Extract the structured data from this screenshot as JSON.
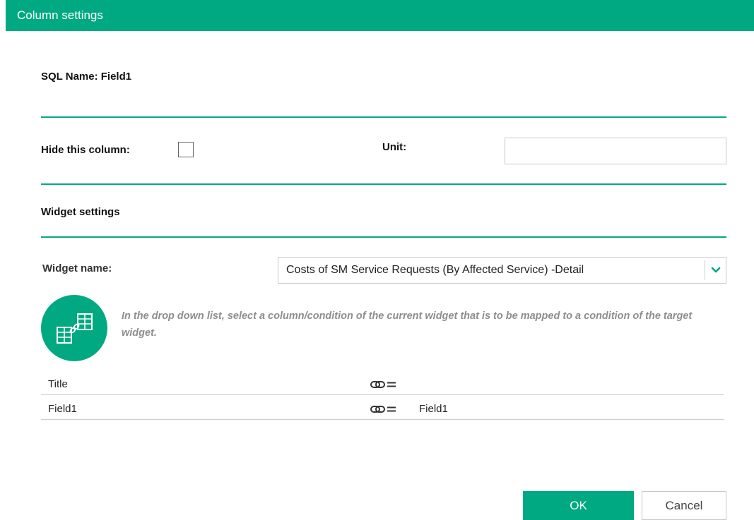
{
  "dialog": {
    "title": "Column settings",
    "sql_name": "SQL Name: Field1",
    "hide_column_label": "Hide this column:",
    "hide_column_checked": false,
    "unit_label": "Unit:",
    "unit_value": "",
    "widget_settings_heading": "Widget settings",
    "widget_name_label": "Widget name:",
    "widget_name_value": "Costs of SM Service Requests (By Affected Service) -Detail",
    "hint": "In the drop down list, select a column/condition of the current widget that is to be mapped to a condition of the target widget.",
    "mapping_rows": [
      {
        "column": "Title",
        "target": ""
      },
      {
        "column": "Field1",
        "target": "Field1"
      }
    ],
    "ok_label": "OK",
    "cancel_label": "Cancel"
  },
  "colors": {
    "accent": "#01a982",
    "hint_text": "#8e8e8e",
    "divider": "#01a982"
  },
  "icons": {
    "dropdown": "chevron-down-icon",
    "mapping": "table-link-icon",
    "link": "link-equals-icon"
  }
}
